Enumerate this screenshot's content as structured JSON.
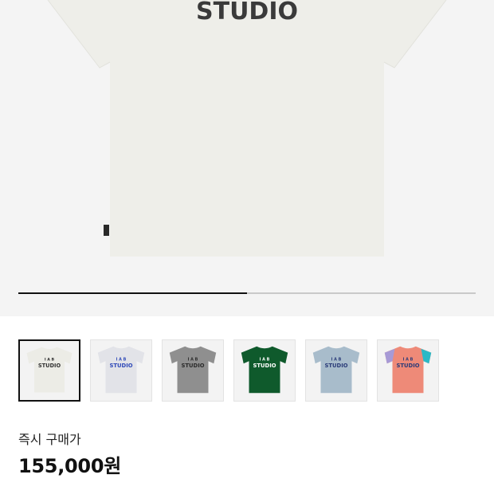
{
  "hero": {
    "brand_text": "STUDIO",
    "shirt_color": "#eeeee9",
    "background": "#f4f4f4",
    "carousel_progress": 0.5
  },
  "thumbnails": [
    {
      "shirt_color": "#ececE6",
      "letters_color": "#333333",
      "studio_color": "#333333",
      "sleeve_left": "",
      "sleeve_right": "",
      "selected": true
    },
    {
      "shirt_color": "#e2e3e8",
      "letters_color": "#2f49b8",
      "studio_color": "#2f49b8",
      "sleeve_left": "",
      "sleeve_right": "",
      "selected": false
    },
    {
      "shirt_color": "#8f8f8f",
      "letters_color": "#2b2b2b",
      "studio_color": "#2b2b2b",
      "sleeve_left": "",
      "sleeve_right": "",
      "selected": false
    },
    {
      "shirt_color": "#0f5a2c",
      "letters_color": "#ffffff",
      "studio_color": "#ffffff",
      "sleeve_left": "",
      "sleeve_right": "",
      "selected": false
    },
    {
      "shirt_color": "#a8bccb",
      "letters_color": "#2a3b78",
      "studio_color": "#2a3b78",
      "sleeve_left": "",
      "sleeve_right": "",
      "selected": false
    },
    {
      "shirt_color": "#ee8a78",
      "letters_color": "#2a3b78",
      "studio_color": "#2a3b78",
      "sleeve_left": "#a79ad6",
      "sleeve_right": "#2bb9c6",
      "selected": false
    }
  ],
  "thumb_brand": {
    "letters": "I A B",
    "studio": "STUDIO"
  },
  "price": {
    "label": "즉시 구매가",
    "value": "155,000원"
  }
}
